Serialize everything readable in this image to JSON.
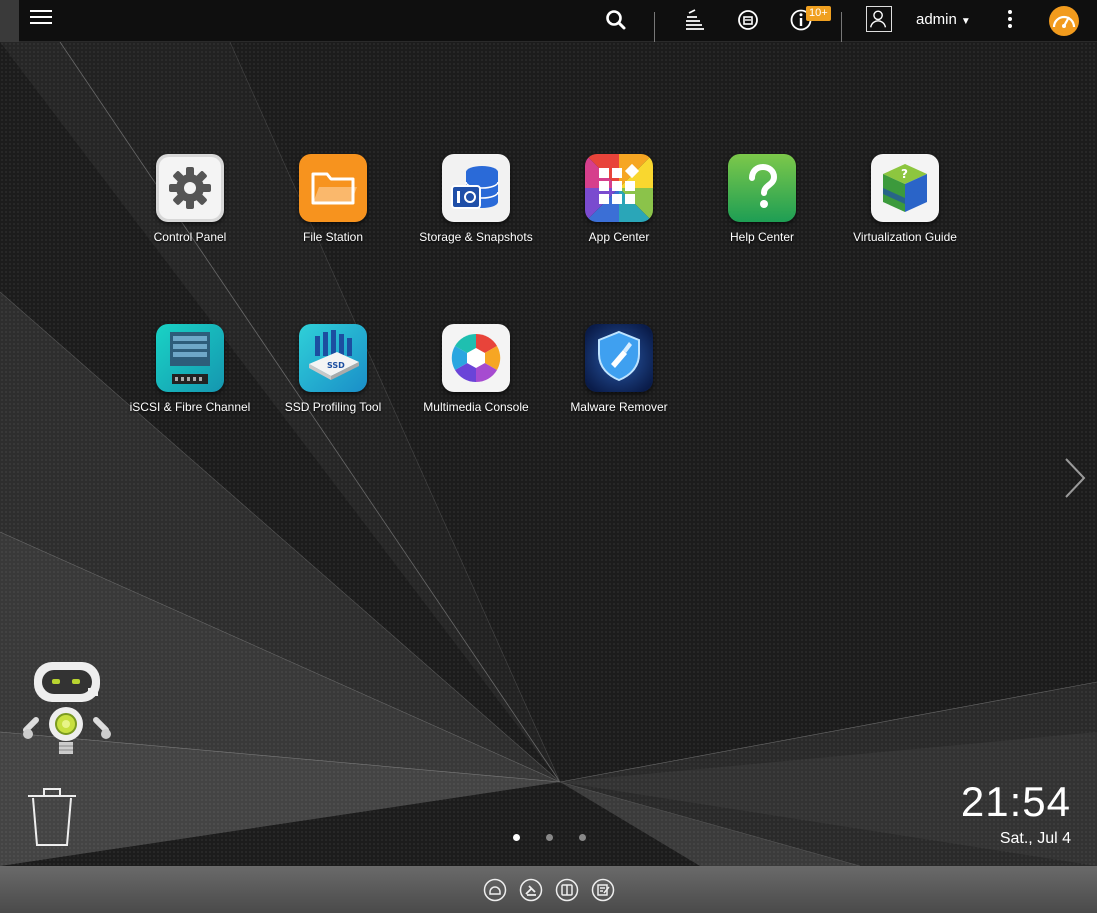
{
  "topbar": {
    "notifications_badge": "10+",
    "username": "admin",
    "icons": [
      "menu-icon",
      "search-icon",
      "background-tasks-icon",
      "external-device-icon",
      "event-notifications-icon",
      "user-icon",
      "more-options-icon",
      "dashboard-icon"
    ]
  },
  "apps": [
    {
      "label": "Control Panel",
      "icon": "gear-icon"
    },
    {
      "label": "File Station",
      "icon": "folder-icon"
    },
    {
      "label": "Storage & Snapshots",
      "icon": "storage-icon"
    },
    {
      "label": "App Center",
      "icon": "app-grid-icon"
    },
    {
      "label": "Help Center",
      "icon": "question-mark-icon"
    },
    {
      "label": "Virtualization Guide",
      "icon": "virtualization-cube-icon"
    },
    {
      "label": "iSCSI & Fibre Channel",
      "icon": "iscsi-server-icon"
    },
    {
      "label": "SSD Profiling Tool",
      "icon": "ssd-icon"
    },
    {
      "label": "Multimedia Console",
      "icon": "multimedia-hexagon-icon"
    },
    {
      "label": "Malware Remover",
      "icon": "shield-broom-icon"
    }
  ],
  "clock": {
    "time": "21:54",
    "date": "Sat., Jul 4"
  },
  "pager": {
    "pages": 3,
    "current": 1
  },
  "dock": {
    "icons": [
      "qnap-logo-icon",
      "helpdesk-icon",
      "manual-icon",
      "feedback-icon"
    ]
  },
  "colors": {
    "topbar": "#0f0f0f",
    "badge": "#f0a020",
    "dock": "#5a5a5a"
  }
}
